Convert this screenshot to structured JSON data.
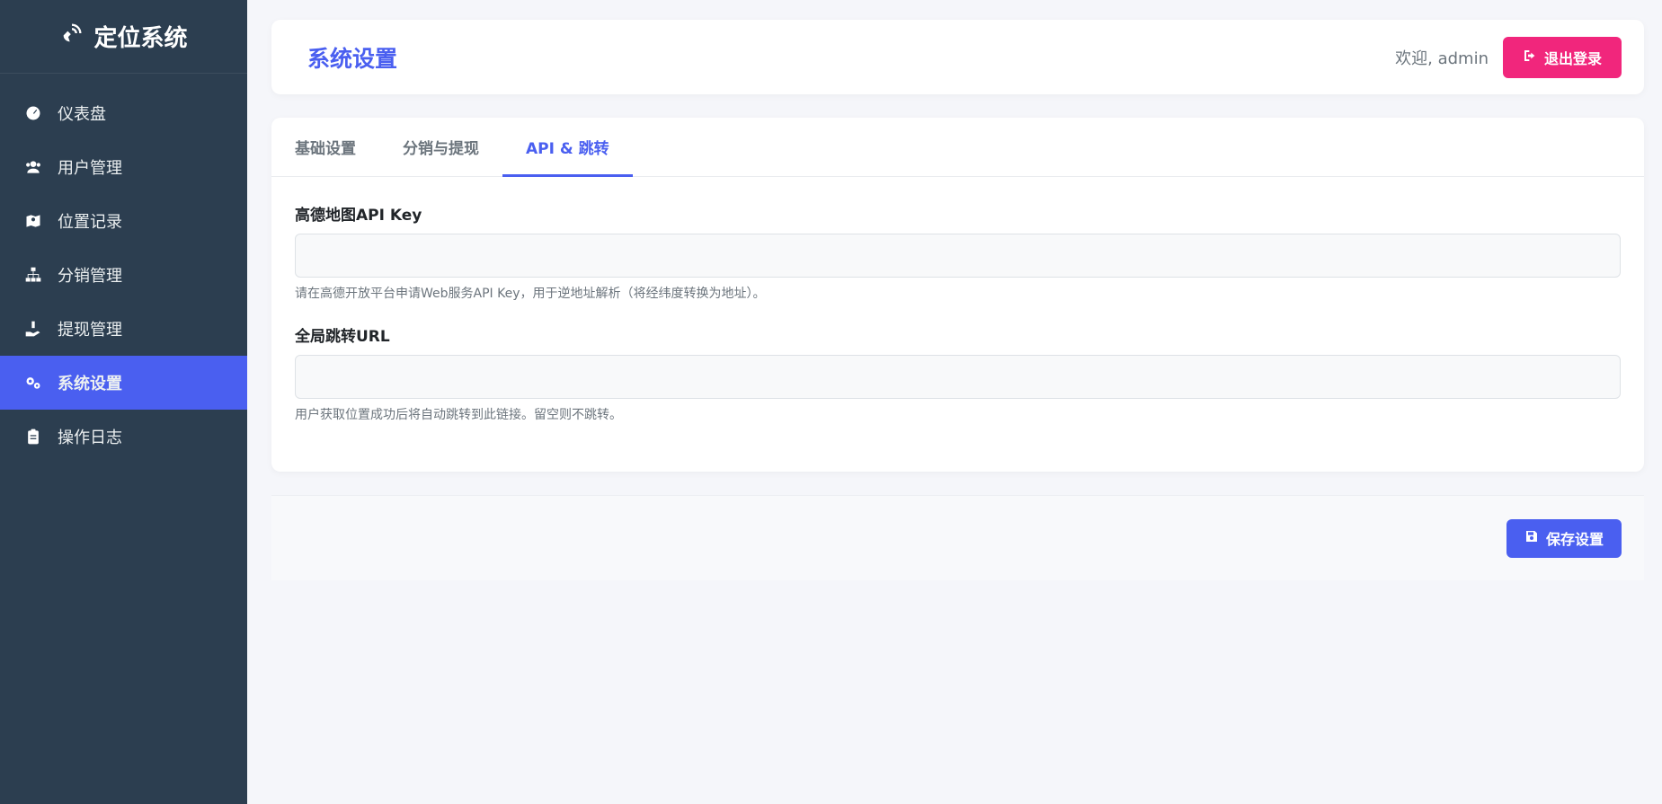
{
  "brand": {
    "title": "定位系统",
    "icon": "satellite-dish-icon"
  },
  "sidebar": {
    "items": [
      {
        "label": "仪表盘",
        "icon": "tachometer-icon",
        "active": false
      },
      {
        "label": "用户管理",
        "icon": "users-icon",
        "active": false
      },
      {
        "label": "位置记录",
        "icon": "map-marked-icon",
        "active": false
      },
      {
        "label": "分销管理",
        "icon": "sitemap-icon",
        "active": false
      },
      {
        "label": "提现管理",
        "icon": "hand-holding-dollar-icon",
        "active": false
      },
      {
        "label": "系统设置",
        "icon": "cogs-icon",
        "active": true
      },
      {
        "label": "操作日志",
        "icon": "clipboard-list-icon",
        "active": false
      }
    ]
  },
  "header": {
    "title": "系统设置",
    "welcome": "欢迎, admin",
    "logout_label": "退出登录"
  },
  "tabs": [
    {
      "label": "基础设置",
      "active": false
    },
    {
      "label": "分销与提现",
      "active": false
    },
    {
      "label": "API & 跳转",
      "active": true
    }
  ],
  "form": {
    "amap_key": {
      "label": "高德地图API Key",
      "value": "",
      "help": "请在高德开放平台申请Web服务API Key，用于逆地址解析（将经纬度转换为地址）。"
    },
    "redirect_url": {
      "label": "全局跳转URL",
      "value": "",
      "help": "用户获取位置成功后将自动跳转到此链接。留空则不跳转。"
    }
  },
  "footer": {
    "save_label": "保存设置"
  },
  "colors": {
    "sidebar_bg": "#2c3e50",
    "accent": "#4a5ff0",
    "logout": "#f1267c"
  }
}
